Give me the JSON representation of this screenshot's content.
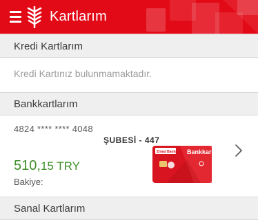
{
  "header": {
    "title": "Kartlarım",
    "bg_color": "#e30a17"
  },
  "sections": {
    "credit": {
      "title": "Kredi Kartlarım",
      "empty_message": "Kredi Kartınız bulunmamaktadır."
    },
    "bank": {
      "title": "Bankkartlarım"
    },
    "virtual": {
      "title": "Sanal Kartlarım"
    }
  },
  "card": {
    "number": "4824 ****  **** 4048",
    "branch": "ŞUBESİ -   447",
    "amount_whole": "510,",
    "amount_rest": "15 TRY",
    "balance_label": "Bakiye:",
    "card_brand": "Bankkart",
    "card_bank": "Ziraat Bankası",
    "card_color": "#e30a17",
    "amount_color": "#3f8e2b"
  }
}
